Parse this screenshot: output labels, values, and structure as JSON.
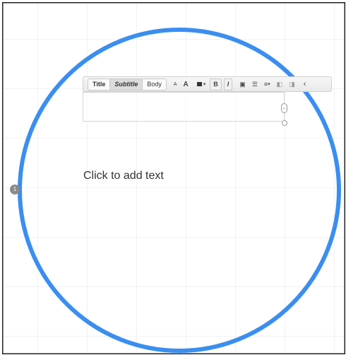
{
  "canvas": {
    "placeholder_text": "Click to add text",
    "connection_point_label": "1",
    "circle_color": "#3a8ef0"
  },
  "toolbar": {
    "style_buttons": [
      "Title",
      "Subtitle",
      "Body"
    ],
    "selected_style": "Subtitle",
    "font_smaller": "A",
    "font_larger": "A",
    "bold": "B",
    "italic": "I",
    "text_box_icon": "▣",
    "list_icon": "☰",
    "align_icon": "≡",
    "align_caret": "▾",
    "indent_less": "◧",
    "indent_more": "◨",
    "collapse": "‹",
    "color_caret": "▾"
  },
  "handles": {
    "resize_label": "↔"
  }
}
